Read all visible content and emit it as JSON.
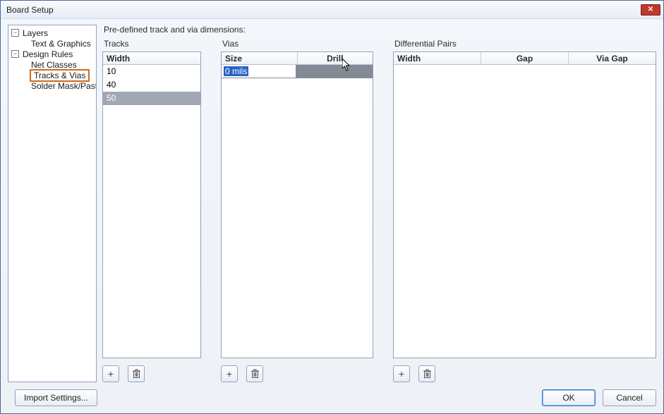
{
  "window": {
    "title": "Board Setup"
  },
  "tree": {
    "layers": "Layers",
    "text_graphics": "Text & Graphics",
    "design_rules": "Design Rules",
    "net_classes": "Net Classes",
    "tracks_vias": "Tracks & Vias",
    "solder_mask": "Solder Mask/Paste"
  },
  "content": {
    "heading": "Pre-defined track and via dimensions:",
    "tracks": {
      "label": "Tracks",
      "col_width": "Width",
      "rows": [
        "10",
        "40",
        "50"
      ]
    },
    "vias": {
      "label": "Vias",
      "col_size": "Size",
      "col_drill": "Drill",
      "edit_value": "0 mils"
    },
    "diff": {
      "label": "Differential Pairs",
      "col_width": "Width",
      "col_gap": "Gap",
      "col_viagap": "Via Gap"
    }
  },
  "buttons": {
    "import": "Import Settings...",
    "ok": "OK",
    "cancel": "Cancel",
    "add": "+",
    "delete_title": "Delete"
  }
}
